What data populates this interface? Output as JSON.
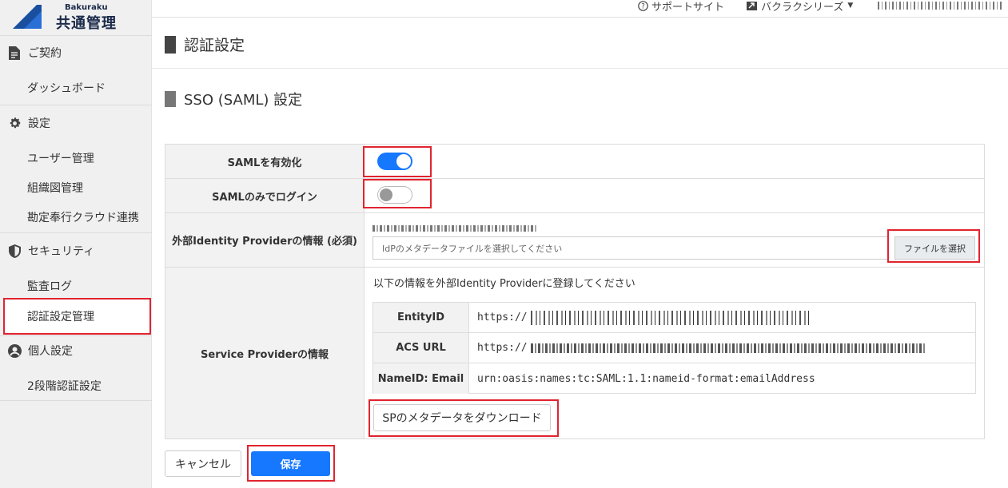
{
  "app": {
    "brand": "Bakuraku",
    "title": "共通管理"
  },
  "topbar": {
    "support_label": "サポートサイト",
    "series_label": "バクラクシリーズ"
  },
  "sidebar": {
    "contract": "ご契約",
    "dashboard": "ダッシュボード",
    "settings": "設定",
    "user_mgmt": "ユーザー管理",
    "org_chart": "組織図管理",
    "kanjo_link": "勘定奉行クラウド連携",
    "security": "セキュリティ",
    "audit_log": "監査ログ",
    "auth_settings": "認証設定管理",
    "personal": "個人設定",
    "two_factor": "2段階認証設定"
  },
  "page": {
    "title": "認証設定",
    "section_title": "SSO (SAML) 設定"
  },
  "form": {
    "saml_enable_label": "SAMLを有効化",
    "saml_enable": true,
    "saml_only_label": "SAMLのみでログイン",
    "saml_only": false,
    "idp_label": "外部Identity Providerの情報 (必須)",
    "idp_placeholder": "IdPのメタデータファイルを選択してください",
    "file_button": "ファイルを選択",
    "sp_label": "Service Providerの情報",
    "sp_note": "以下の情報を外部Identity Providerに登録してください",
    "entity_id_label": "EntityID",
    "entity_id_value": "https://",
    "acs_url_label": "ACS URL",
    "acs_url_value": "https://",
    "nameid_label": "NameID: Email",
    "nameid_value": "urn:oasis:names:tc:SAML:1.1:nameid-format:emailAddress",
    "download_button": "SPのメタデータをダウンロード"
  },
  "actions": {
    "cancel": "キャンセル",
    "save": "保存"
  },
  "colors": {
    "accent": "#1677ff",
    "highlight": "#e0242f"
  }
}
